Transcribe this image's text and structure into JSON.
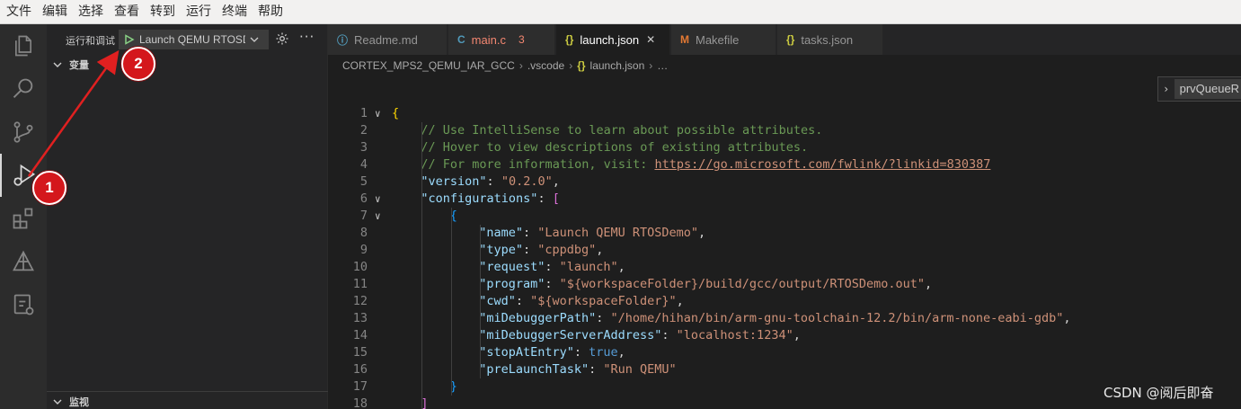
{
  "menu": [
    "文件",
    "编辑",
    "选择",
    "查看",
    "转到",
    "运行",
    "终端",
    "帮助"
  ],
  "activity_bar": [
    {
      "name": "explorer-icon"
    },
    {
      "name": "search-icon"
    },
    {
      "name": "source-control-icon"
    },
    {
      "name": "run-debug-icon",
      "active": true
    },
    {
      "name": "extensions-icon"
    },
    {
      "name": "remote-explorer-icon"
    },
    {
      "name": "cmake-icon"
    }
  ],
  "sidebar": {
    "title": "运行和调试",
    "launch_config": "Launch QEMU RTOSDemo",
    "sections": {
      "variables": "变量",
      "watch": "监视"
    }
  },
  "tabs": [
    {
      "icon": "ⓘ",
      "icon_color": "#519aba",
      "label": "Readme.md"
    },
    {
      "icon": "C",
      "icon_color": "#519aba",
      "label": "main.c",
      "badge": "3",
      "label_color": "#f48771"
    },
    {
      "icon": "{}",
      "icon_color": "#cbcb41",
      "label": "launch.json",
      "active": true,
      "close": "✕"
    },
    {
      "icon": "M",
      "icon_color": "#e37933",
      "label": "Makefile"
    },
    {
      "icon": "{}",
      "icon_color": "#cbcb41",
      "label": "tasks.json"
    }
  ],
  "breadcrumb": [
    "CORTEX_MPS2_QEMU_IAR_GCC",
    ".vscode",
    "launch.json",
    "…"
  ],
  "sticky": {
    "text": "prvQueueR"
  },
  "editor": {
    "lines": [
      {
        "n": "1",
        "fold": "∨",
        "indent": 0,
        "tokens": [
          {
            "t": "{",
            "c": "c-br1"
          }
        ]
      },
      {
        "n": "2",
        "indent": 1,
        "tokens": [
          {
            "t": "// Use IntelliSense to learn about possible attributes.",
            "c": "c-com"
          }
        ]
      },
      {
        "n": "3",
        "indent": 1,
        "tokens": [
          {
            "t": "// Hover to view descriptions of existing attributes.",
            "c": "c-com"
          }
        ]
      },
      {
        "n": "4",
        "indent": 1,
        "tokens": [
          {
            "t": "// For more information, visit: ",
            "c": "c-com"
          },
          {
            "t": "https://go.microsoft.com/fwlink/?linkid=830387",
            "c": "c-com",
            "link": true
          }
        ]
      },
      {
        "n": "5",
        "indent": 1,
        "tokens": [
          {
            "t": "\"version\"",
            "c": "c-key"
          },
          {
            "t": ": ",
            "c": "c-p"
          },
          {
            "t": "\"0.2.0\"",
            "c": "c-str"
          },
          {
            "t": ",",
            "c": "c-p"
          }
        ]
      },
      {
        "n": "6",
        "fold": "∨",
        "indent": 1,
        "tokens": [
          {
            "t": "\"configurations\"",
            "c": "c-key"
          },
          {
            "t": ": ",
            "c": "c-p"
          },
          {
            "t": "[",
            "c": "c-br2"
          }
        ]
      },
      {
        "n": "7",
        "fold": "∨",
        "indent": 2,
        "tokens": [
          {
            "t": "{",
            "c": "c-br3"
          }
        ]
      },
      {
        "n": "8",
        "indent": 3,
        "tokens": [
          {
            "t": "\"name\"",
            "c": "c-key"
          },
          {
            "t": ": ",
            "c": "c-p"
          },
          {
            "t": "\"Launch QEMU RTOSDemo\"",
            "c": "c-str"
          },
          {
            "t": ",",
            "c": "c-p"
          }
        ]
      },
      {
        "n": "9",
        "indent": 3,
        "tokens": [
          {
            "t": "\"type\"",
            "c": "c-key"
          },
          {
            "t": ": ",
            "c": "c-p"
          },
          {
            "t": "\"cppdbg\"",
            "c": "c-str"
          },
          {
            "t": ",",
            "c": "c-p"
          }
        ]
      },
      {
        "n": "10",
        "indent": 3,
        "tokens": [
          {
            "t": "\"request\"",
            "c": "c-key"
          },
          {
            "t": ": ",
            "c": "c-p"
          },
          {
            "t": "\"launch\"",
            "c": "c-str"
          },
          {
            "t": ",",
            "c": "c-p"
          }
        ]
      },
      {
        "n": "11",
        "indent": 3,
        "tokens": [
          {
            "t": "\"program\"",
            "c": "c-key"
          },
          {
            "t": ": ",
            "c": "c-p"
          },
          {
            "t": "\"${workspaceFolder}/build/gcc/output/RTOSDemo.out\"",
            "c": "c-str"
          },
          {
            "t": ",",
            "c": "c-p"
          }
        ]
      },
      {
        "n": "12",
        "indent": 3,
        "tokens": [
          {
            "t": "\"cwd\"",
            "c": "c-key"
          },
          {
            "t": ": ",
            "c": "c-p"
          },
          {
            "t": "\"${workspaceFolder}\"",
            "c": "c-str"
          },
          {
            "t": ",",
            "c": "c-p"
          }
        ]
      },
      {
        "n": "13",
        "indent": 3,
        "tokens": [
          {
            "t": "\"miDebuggerPath\"",
            "c": "c-key"
          },
          {
            "t": ": ",
            "c": "c-p"
          },
          {
            "t": "\"/home/hihan/bin/arm-gnu-toolchain-12.2/bin/arm-none-eabi-gdb\"",
            "c": "c-str"
          },
          {
            "t": ",",
            "c": "c-p"
          }
        ]
      },
      {
        "n": "14",
        "indent": 3,
        "tokens": [
          {
            "t": "\"miDebuggerServerAddress\"",
            "c": "c-key"
          },
          {
            "t": ": ",
            "c": "c-p"
          },
          {
            "t": "\"localhost:1234\"",
            "c": "c-str"
          },
          {
            "t": ",",
            "c": "c-p"
          }
        ]
      },
      {
        "n": "15",
        "indent": 3,
        "tokens": [
          {
            "t": "\"stopAtEntry\"",
            "c": "c-key"
          },
          {
            "t": ": ",
            "c": "c-p"
          },
          {
            "t": "true",
            "c": "c-lit"
          },
          {
            "t": ",",
            "c": "c-p"
          }
        ]
      },
      {
        "n": "16",
        "indent": 3,
        "tokens": [
          {
            "t": "\"preLaunchTask\"",
            "c": "c-key"
          },
          {
            "t": ": ",
            "c": "c-p"
          },
          {
            "t": "\"Run QEMU\"",
            "c": "c-str"
          }
        ]
      },
      {
        "n": "17",
        "indent": 2,
        "tokens": [
          {
            "t": "}",
            "c": "c-br3"
          }
        ]
      },
      {
        "n": "18",
        "indent": 1,
        "tokens": [
          {
            "t": "]",
            "c": "c-br2"
          }
        ]
      }
    ]
  },
  "annotations": [
    {
      "label": "1"
    },
    {
      "label": "2"
    }
  ],
  "watermark": "CSDN @阅后即奋",
  "colors": {
    "accent_red": "#d4171c",
    "play_green": "#89d185",
    "editor_bg": "#1e1e1e"
  }
}
